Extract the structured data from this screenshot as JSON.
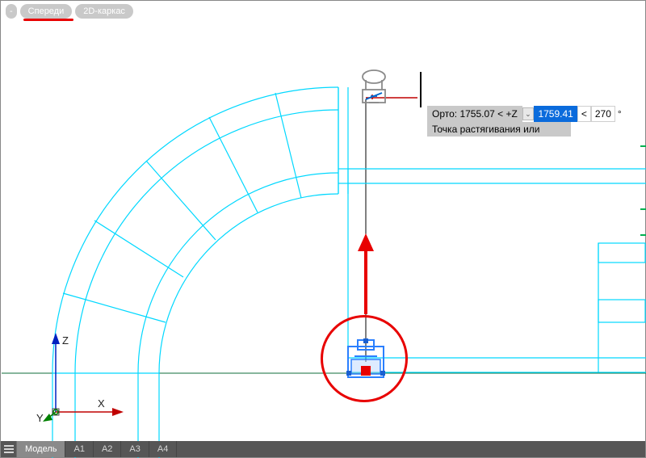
{
  "view_pills": {
    "minus": "-",
    "front": "Спереди",
    "wire": "2D-каркас"
  },
  "coord_labels": {
    "z": "Z",
    "y": "Y",
    "x": "X"
  },
  "tooltip": {
    "line1": "Орто: 1755.07 < +Z",
    "value": "1759.41",
    "lt": "<",
    "angle": "270",
    "deg": "°",
    "line2": "Точка растягивания или"
  },
  "tabs": {
    "model": "Модель",
    "a1": "А1",
    "a2": "А2",
    "a3": "А3",
    "a4": "А4"
  }
}
